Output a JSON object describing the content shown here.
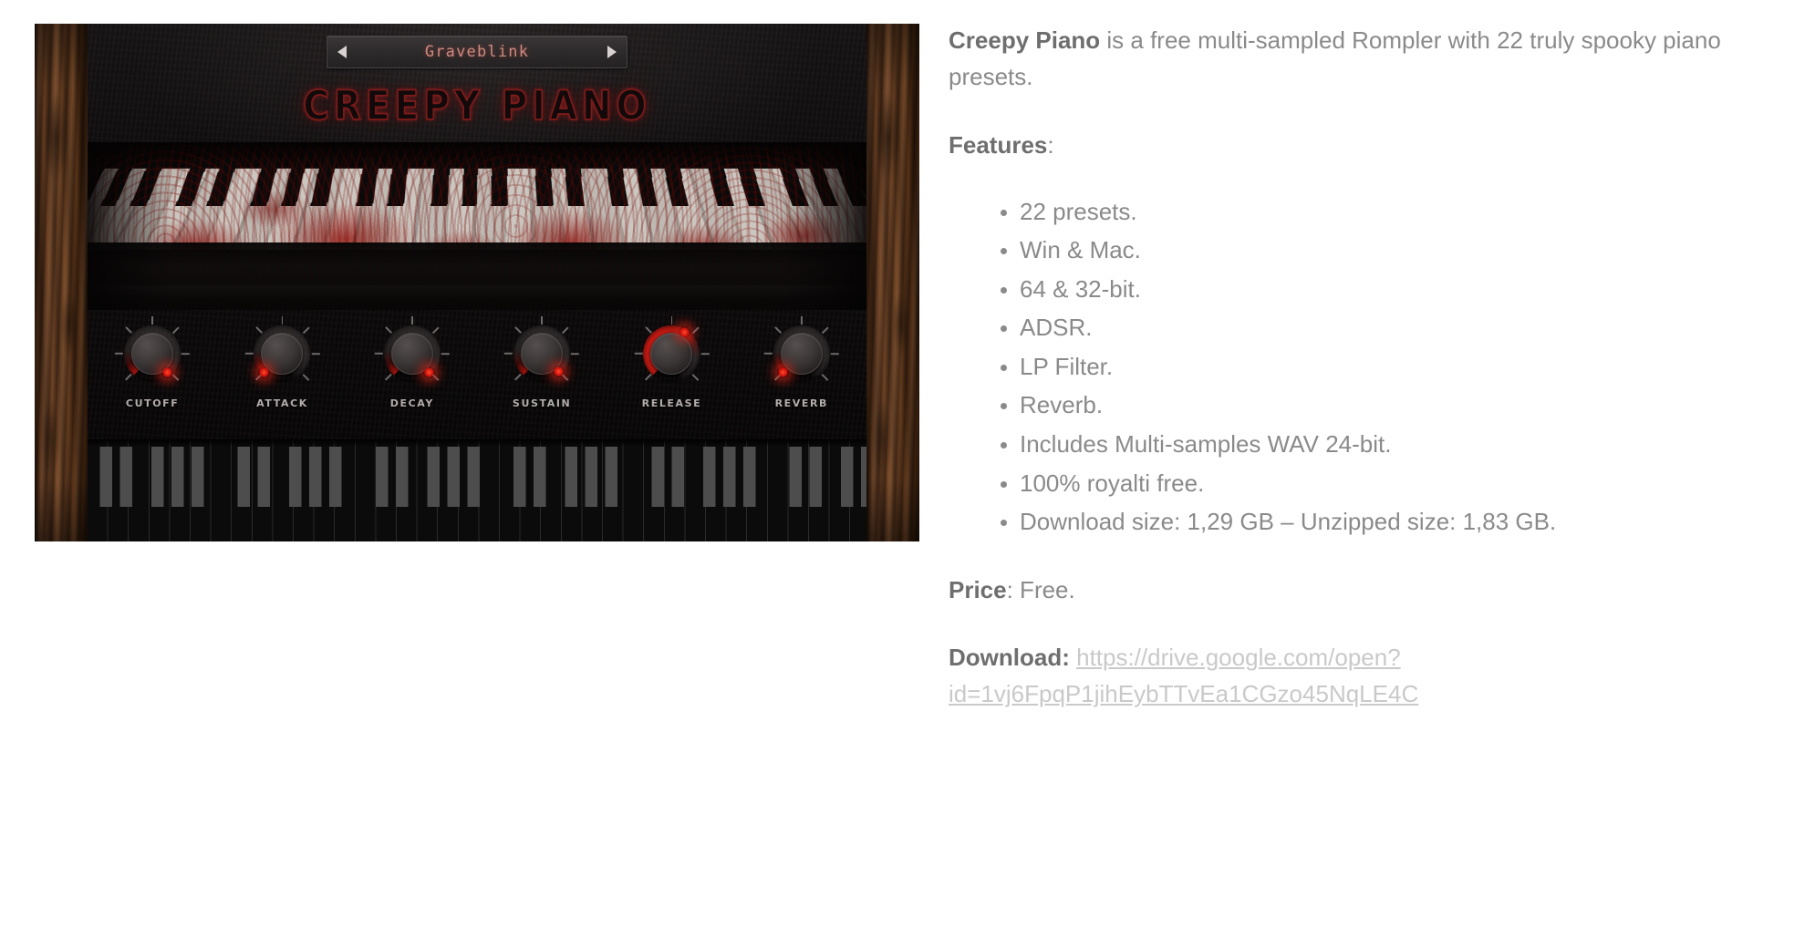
{
  "plugin": {
    "preset": {
      "name": "Graveblink",
      "prev_label": "◀",
      "next_label": "▶"
    },
    "logo_text": "CREEPY PIANO",
    "knobs": [
      {
        "label": "CUTOFF",
        "value_pct": 18,
        "angle": 225
      },
      {
        "label": "ATTACK",
        "value_pct": 6,
        "angle": 212
      },
      {
        "label": "DECAY",
        "value_pct": 20,
        "angle": 228
      },
      {
        "label": "SUSTAIN",
        "value_pct": 22,
        "angle": 232
      },
      {
        "label": "RELEASE",
        "value_pct": 92,
        "angle": 338
      },
      {
        "label": "REVERB",
        "value_pct": 5,
        "angle": 210
      }
    ],
    "colors": {
      "accent_red": "#d2140c",
      "preset_text": "#c98b80",
      "wood": "#7d4d2b",
      "panel": "#0a0809"
    }
  },
  "article": {
    "lead_strong": "Creepy Piano",
    "lead_rest": " is a free multi-sampled Rompler with 22 truly spooky piano presets.",
    "features_label": "Features",
    "features_colon": ":",
    "features": [
      "22 presets.",
      "Win & Mac.",
      "64 & 32-bit.",
      "ADSR.",
      "LP Filter.",
      "Reverb.",
      "Includes Multi-samples WAV 24-bit.",
      "100% royalti free.",
      "Download size: 1,29 GB – Unzipped size: 1,83 GB."
    ],
    "price_label": "Price",
    "price_value": ": Free.",
    "download_label": "Download:",
    "download_url": "https://drive.google.com/open?id=1vj6FpqP1jihEybTTvEa1CGzo45NqLE4C"
  }
}
